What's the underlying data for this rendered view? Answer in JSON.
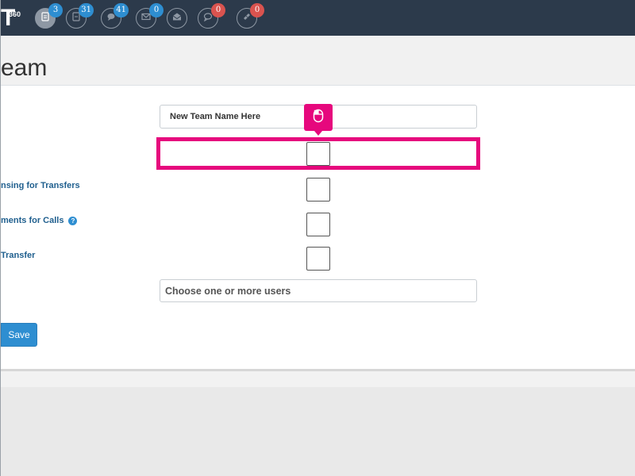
{
  "header": {
    "brand_text": "T",
    "brand_sup": "360",
    "nav_icons": [
      {
        "icon": "document-icon",
        "count": "3",
        "badge_color": "#2e8ed1"
      },
      {
        "icon": "report-icon",
        "count": "31",
        "badge_color": "#2e8ed1"
      },
      {
        "icon": "chat-icon",
        "count": "41",
        "badge_color": "#2e8ed1"
      },
      {
        "icon": "mail-icon",
        "count": "0",
        "badge_color": "#2e8ed1"
      },
      {
        "icon": "open-mail-icon",
        "count": "",
        "badge_color": ""
      },
      {
        "icon": "comment-icon",
        "count": "0",
        "badge_color": "#d9534f"
      },
      {
        "icon": "ticket-icon",
        "count": "0",
        "badge_color": "#d9534f"
      }
    ]
  },
  "page": {
    "title": "eam"
  },
  "form": {
    "team_name_placeholder": "New Team Name Here",
    "labels": {
      "dispensing": "nsing for Transfers",
      "comments": "ments for Calls",
      "transfer": "Transfer"
    },
    "users_placeholder": "Choose one or more users",
    "save_label": "Save"
  },
  "colors": {
    "topbar": "#2c3a4b",
    "accent": "#2e8ed1",
    "highlight": "#e6087d",
    "label": "#21608f"
  }
}
